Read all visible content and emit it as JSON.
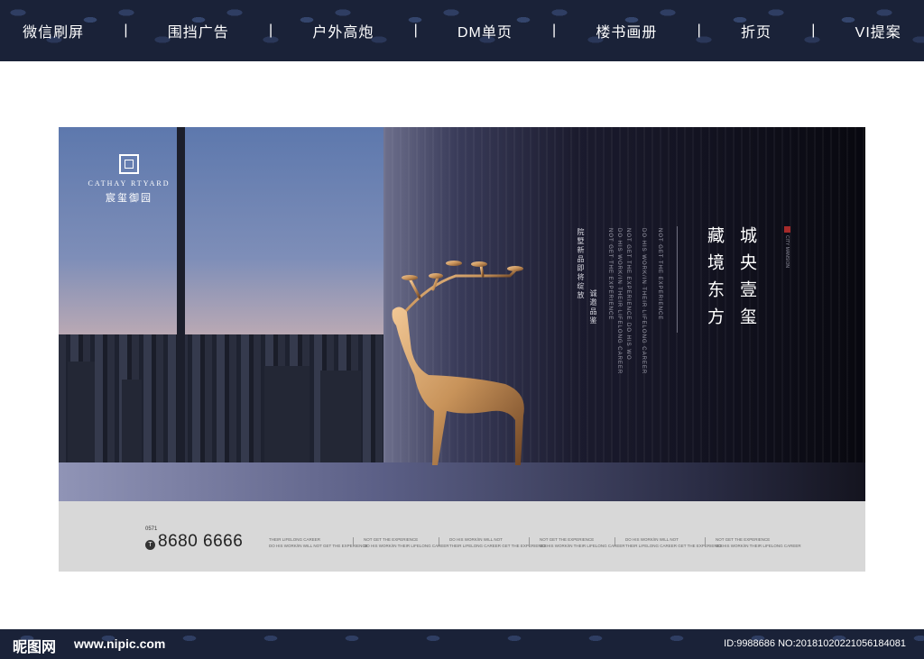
{
  "nav": {
    "items": [
      "微信刷屏",
      "围挡广告",
      "户外高炮",
      "DM单页",
      "楼书画册",
      "折页",
      "VI提案"
    ],
    "separator": "|"
  },
  "poster": {
    "logo_en": "CATHAY RTYARD",
    "logo_cn": "宸玺御园",
    "vertical_cn": [
      "院墅新品即将绽放",
      "诚邀品鉴"
    ],
    "vertical_en": [
      "NOT GET THE EXPERIENCE",
      "DO HIS WORK/IN THEIR LIFELONG CAREER",
      "NOT GET THE EXPERIENCE  DO HIS WO",
      "DO HIS WORK/IN THEIR LIFELONG CAREER",
      "NOT GET THE EXPERIENCE"
    ],
    "slogan_left": "藏境东方",
    "slogan_right": "城央壹玺",
    "seal_text": "CITY MANSION",
    "area_code": "0571",
    "phone_icon": "T",
    "phone": "8680 6666",
    "bottom_slogans": [
      [
        "THEIR LIFELONG CAREER",
        "DO HIS WORK/IN WILL NOT GET THE EXPERIENCE"
      ],
      [
        "NOT GET THE EXPERIENCE",
        "DO HIS WORK/IN THEIR LIFELONG CAREER"
      ],
      [
        "DO HIS WORK/IN WILL NOT",
        "THEIR LIFELONG CAREER GET THE EXPERIENCE"
      ],
      [
        "NOT GET THE EXPERIENCE",
        "DO HIS WORK/IN THEIR LIFELONG CAREER"
      ],
      [
        "DO HIS WORK/IN WILL NOT",
        "THEIR LIFELONG CAREER GET THE EXPERIENCE"
      ],
      [
        "NOT GET THE EXPERIENCE",
        "DO HIS WORK/IN THEIR LIFELONG CAREER"
      ]
    ]
  },
  "footer": {
    "brand": "昵图网",
    "url": "www.nipic.com",
    "id_text": "ID:9988686 NO:20181020221056184081"
  },
  "colors": {
    "nav_bg": "#1a2238",
    "deer_gold": "#c8935a"
  }
}
